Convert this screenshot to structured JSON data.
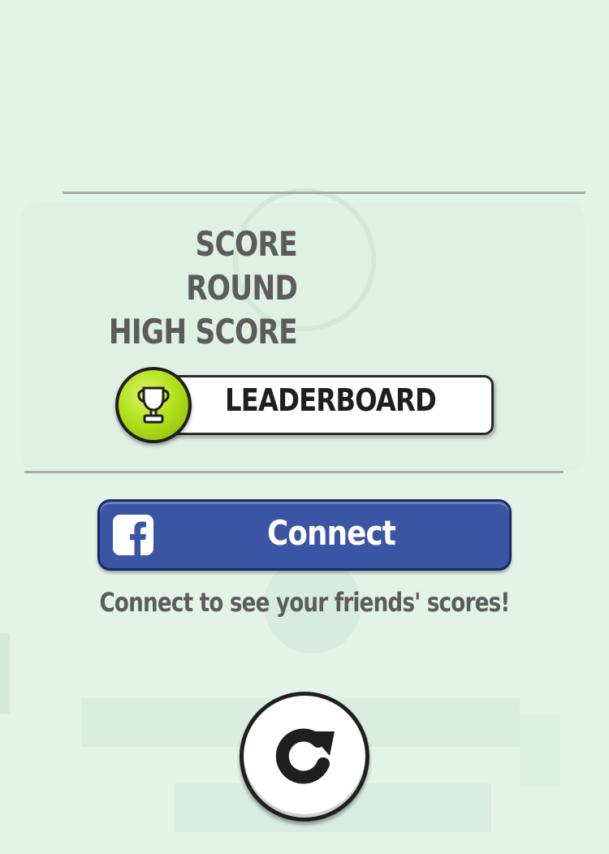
{
  "stats": {
    "score_label": "SCORE",
    "round_label": "ROUND",
    "high_score_label": "HIGH SCORE"
  },
  "leaderboard": {
    "label": "LEADERBOARD",
    "icon": "trophy-icon"
  },
  "facebook": {
    "button_label": "Connect",
    "icon": "facebook-icon",
    "hint": "Connect to see your friends' scores!"
  },
  "replay": {
    "icon": "replay-icon"
  },
  "colors": {
    "background": "#e3f3e8",
    "label_text": "#5c5c5c",
    "facebook_blue": "#3a55a4",
    "trophy_green": "#b4e21c"
  }
}
